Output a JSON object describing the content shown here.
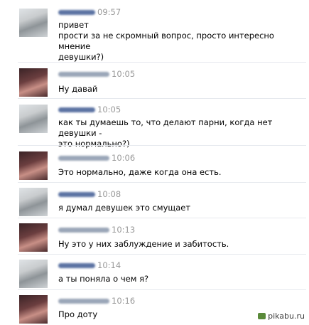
{
  "messages": [
    {
      "sender": "male",
      "time": "09:57",
      "lines": [
        "привет",
        "прости за не скромный вопрос, просто интересно мнение",
        "девушки?)"
      ]
    },
    {
      "sender": "female",
      "time": "10:05",
      "lines": [
        "Ну давай"
      ]
    },
    {
      "sender": "male",
      "time": "10:05",
      "lines": [
        "как ты думаешь то, что делают парни, когда нет девушки -",
        "это нормально?)"
      ]
    },
    {
      "sender": "female",
      "time": "10:06",
      "lines": [
        "Это нормально, даже когда она есть."
      ]
    },
    {
      "sender": "male",
      "time": "10:08",
      "lines": [
        "я думал девушек это смущает"
      ]
    },
    {
      "sender": "female",
      "time": "10:13",
      "lines": [
        "Ну это у них заблуждение и забитость."
      ]
    },
    {
      "sender": "male",
      "time": "10:14",
      "lines": [
        "а ты поняла о чем я?"
      ]
    },
    {
      "sender": "female",
      "time": "10:16",
      "lines": [
        "Про доту"
      ]
    }
  ],
  "watermark": "pikabu.ru"
}
